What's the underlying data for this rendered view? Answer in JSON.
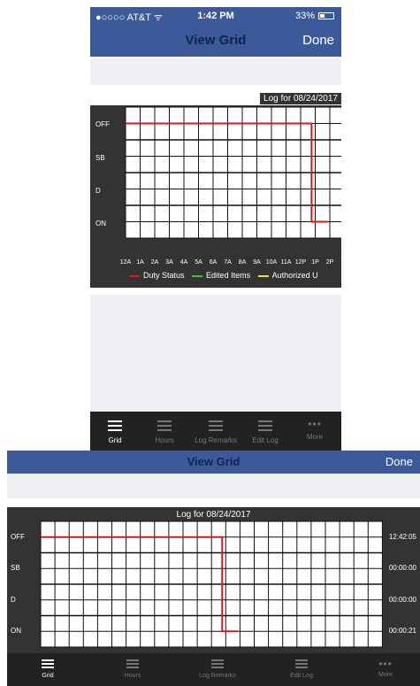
{
  "status_bar": {
    "carrier": "●○○○○ AT&T ᯤ",
    "time": "1:42 PM",
    "battery": "33%"
  },
  "nav": {
    "title": "View Grid",
    "done_label": "Done"
  },
  "grid": {
    "title": "Log for 08/24/2017",
    "rows": [
      "OFF",
      "SB",
      "D",
      "ON"
    ],
    "hours_visible": [
      "12A",
      "1A",
      "2A",
      "3A",
      "4A",
      "5A",
      "6A",
      "7A",
      "8A",
      "9A",
      "10A",
      "11A",
      "12P",
      "1P",
      "2P"
    ],
    "totals": [
      "12:42:05",
      "00:00:00",
      "00:00:00",
      "00:00:21"
    ],
    "line_color": "#d21a1a"
  },
  "legend": [
    {
      "label": "Duty Status",
      "color": "#d21a1a"
    },
    {
      "label": "Edited Items",
      "color": "#32c832"
    },
    {
      "label": "Authorized U",
      "color": "#e6e632"
    }
  ],
  "tabs": [
    {
      "label": "Grid",
      "icon": "list-icon"
    },
    {
      "label": "Hours",
      "icon": "list-icon"
    },
    {
      "label": "Log Remarks",
      "icon": "list-icon"
    },
    {
      "label": "Edit Log",
      "icon": "list-icon"
    },
    {
      "label": "More",
      "icon": "more-dots-icon"
    }
  ],
  "more_glyph": "•••"
}
